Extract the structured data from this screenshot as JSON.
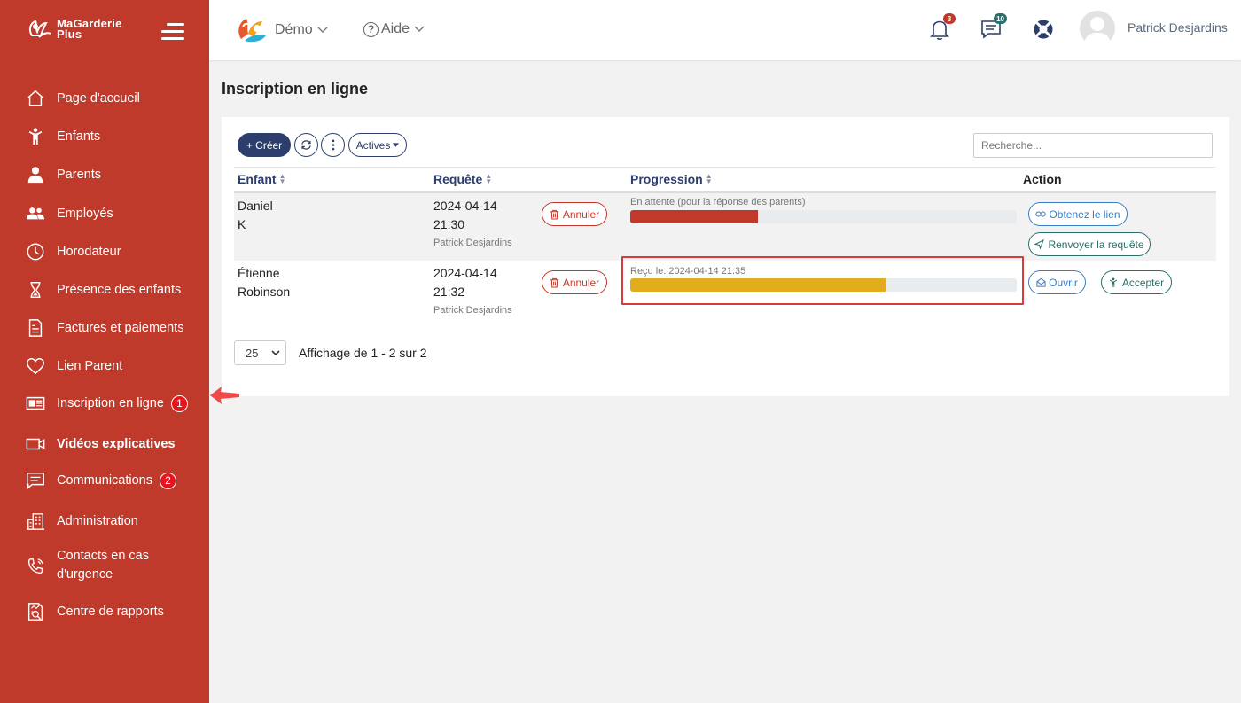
{
  "app": {
    "name_line1": "MaGarderie",
    "name_line2": "Plus"
  },
  "sidebar": {
    "items": [
      {
        "label": "Page d'accueil",
        "icon": "home-icon"
      },
      {
        "label": "Enfants",
        "icon": "child-icon"
      },
      {
        "label": "Parents",
        "icon": "parent-icon"
      },
      {
        "label": "Employés",
        "icon": "employees-icon"
      },
      {
        "label": "Horodateur",
        "icon": "clock-icon"
      },
      {
        "label": "Présence des enfants",
        "icon": "hourglass-icon"
      },
      {
        "label": "Factures et paiements",
        "icon": "invoice-icon"
      },
      {
        "label": "Lien Parent",
        "icon": "heart-icon"
      },
      {
        "label": "Inscription en ligne",
        "icon": "id-card-icon",
        "badge": "1"
      },
      {
        "label": "Vidéos explicatives",
        "icon": "video-icon"
      },
      {
        "label": "Communications",
        "icon": "chat-icon",
        "badge": "2"
      },
      {
        "label": "Administration",
        "icon": "building-icon"
      },
      {
        "label_line1": "Contacts en cas",
        "label_line2": "d'urgence",
        "icon": "phone-icon"
      },
      {
        "label": "Centre de rapports",
        "icon": "report-icon"
      }
    ]
  },
  "topbar": {
    "demo_label": "Démo",
    "aide_label": "Aide",
    "notifications_count": "3",
    "messages_count": "10",
    "user_name": "Patrick Desjardins"
  },
  "page": {
    "title": "Inscription en ligne"
  },
  "toolbar": {
    "create_label": "+ Créer",
    "filter_label": "Actives",
    "search_placeholder": "Recherche..."
  },
  "table": {
    "headers": {
      "enfant": "Enfant",
      "requete": "Requête",
      "progression": "Progression",
      "action": "Action"
    },
    "rows": [
      {
        "first_name": "Daniel",
        "last_name": "K",
        "date": "2024-04-14",
        "time": "21:30",
        "by": "Patrick Desjardins",
        "cancel_label": "Annuler",
        "progress_label": "En attente (pour la réponse des parents)",
        "progress": 0.33,
        "progress_color": "#c0392b",
        "action1": "Obtenez le lien",
        "action2": "Renvoyer la requête"
      },
      {
        "first_name": "Étienne",
        "last_name": "Robinson",
        "date": "2024-04-14",
        "time": "21:32",
        "by": "Patrick Desjardins",
        "cancel_label": "Annuler",
        "progress_label": "Reçu le: 2024-04-14 21:35",
        "progress": 0.66,
        "progress_color": "#e2ad1d",
        "action1": "Ouvrir",
        "action2": "Accepter"
      }
    ]
  },
  "pagination": {
    "page_size": "25",
    "info": "Affichage de 1 - 2 sur 2"
  },
  "colors": {
    "sidebar": "#bf3a2b",
    "primary": "#2c3e6b",
    "danger": "#c0392b",
    "warning": "#e2ad1d",
    "teal": "#2a6f6a"
  }
}
